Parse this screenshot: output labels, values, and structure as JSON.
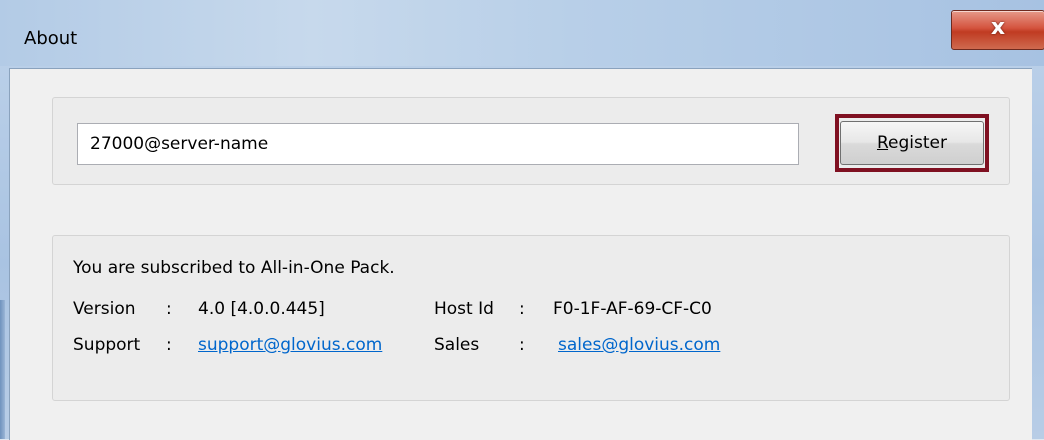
{
  "window": {
    "title": "About",
    "close_glyph": "x"
  },
  "license": {
    "server_value": "27000@server-name",
    "register_label_accel": "R",
    "register_label_rest": "egister"
  },
  "info": {
    "subscription": "You are subscribed to All-in-One Pack.",
    "version_label": "Version",
    "version_sep": ":",
    "version_value": "4.0 [4.0.0.445]",
    "hostid_label": "Host Id",
    "hostid_sep": ":",
    "hostid_value": "F0-1F-AF-69-CF-C0",
    "support_label": "Support",
    "support_sep": ":",
    "support_email": "support@glovius.com",
    "sales_label": "Sales",
    "sales_sep": ":",
    "sales_email": "sales@glovius.com"
  },
  "colors": {
    "highlight_border": "#7f1021",
    "link": "#0066cc",
    "close_button": "#c03b22"
  },
  "icons": {
    "close": "close-icon"
  }
}
